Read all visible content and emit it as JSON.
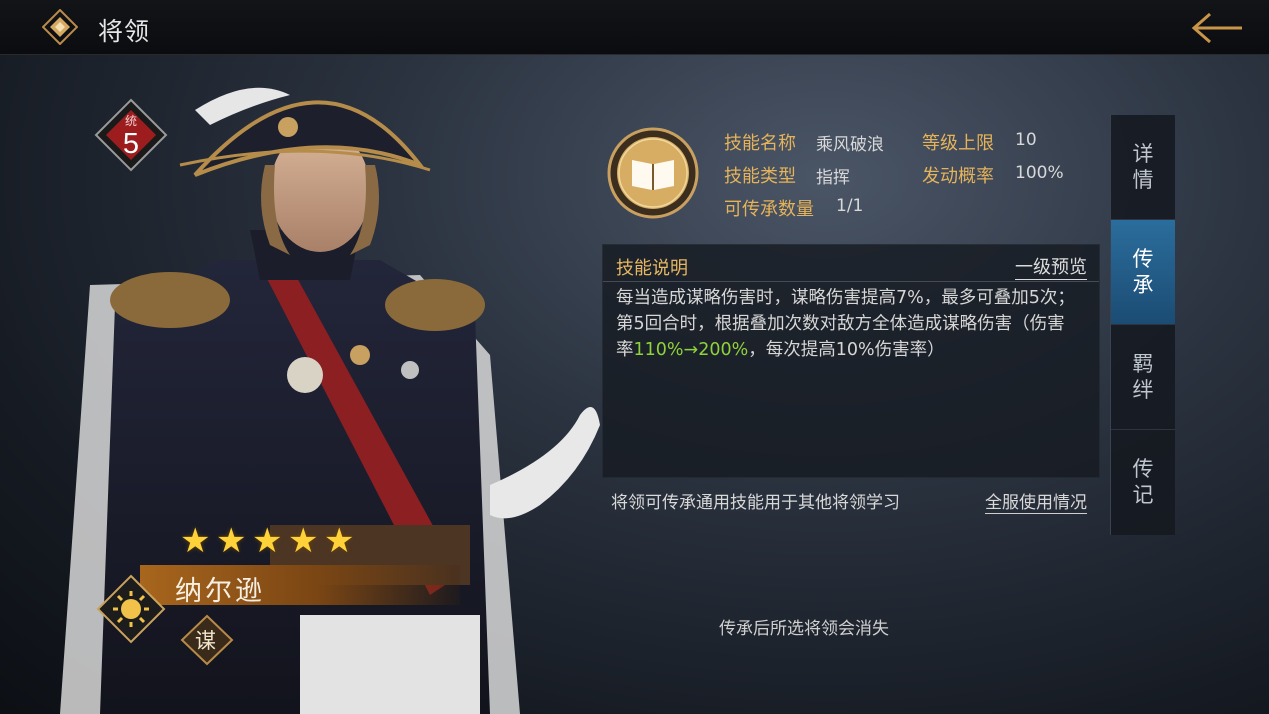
{
  "topbar": {
    "title": "将领"
  },
  "hero": {
    "rank_small": "统",
    "rank_number": "5",
    "stars": 5,
    "name": "纳尔逊",
    "class_label": "谋"
  },
  "skill": {
    "labels": {
      "name": "技能名称",
      "max_level": "等级上限",
      "type": "技能类型",
      "trigger_rate": "发动概率",
      "inherit_count": "可传承数量"
    },
    "values": {
      "name": "乘风破浪",
      "max_level": "10",
      "type": "指挥",
      "trigger_rate": "100%",
      "inherit_count": "1/1"
    }
  },
  "description": {
    "title": "技能说明",
    "preview_link": "一级预览",
    "text_before": "每当造成谋略伤害时，谋略伤害提高7%，最多可叠加5次；第5回合时，根据叠加次数对敌方全体造成谋略伤害（伤害率",
    "text_highlight": "110%→200%",
    "text_after": "，每次提高10%伤害率）"
  },
  "notes": {
    "inherit_note": "将领可传承通用技能用于其他将领学习",
    "usage_link": "全服使用情况",
    "footer": "传承后所选将领会消失"
  },
  "tabs": [
    {
      "label": "详情",
      "active": false
    },
    {
      "label": "传承",
      "active": true
    },
    {
      "label": "羁绊",
      "active": false
    },
    {
      "label": "传记",
      "active": false
    }
  ],
  "colors": {
    "gold_label": "#e5b35a",
    "highlight_green": "#8fd23a",
    "active_tab": "#2b6d9c",
    "star": "#ffd23a"
  }
}
